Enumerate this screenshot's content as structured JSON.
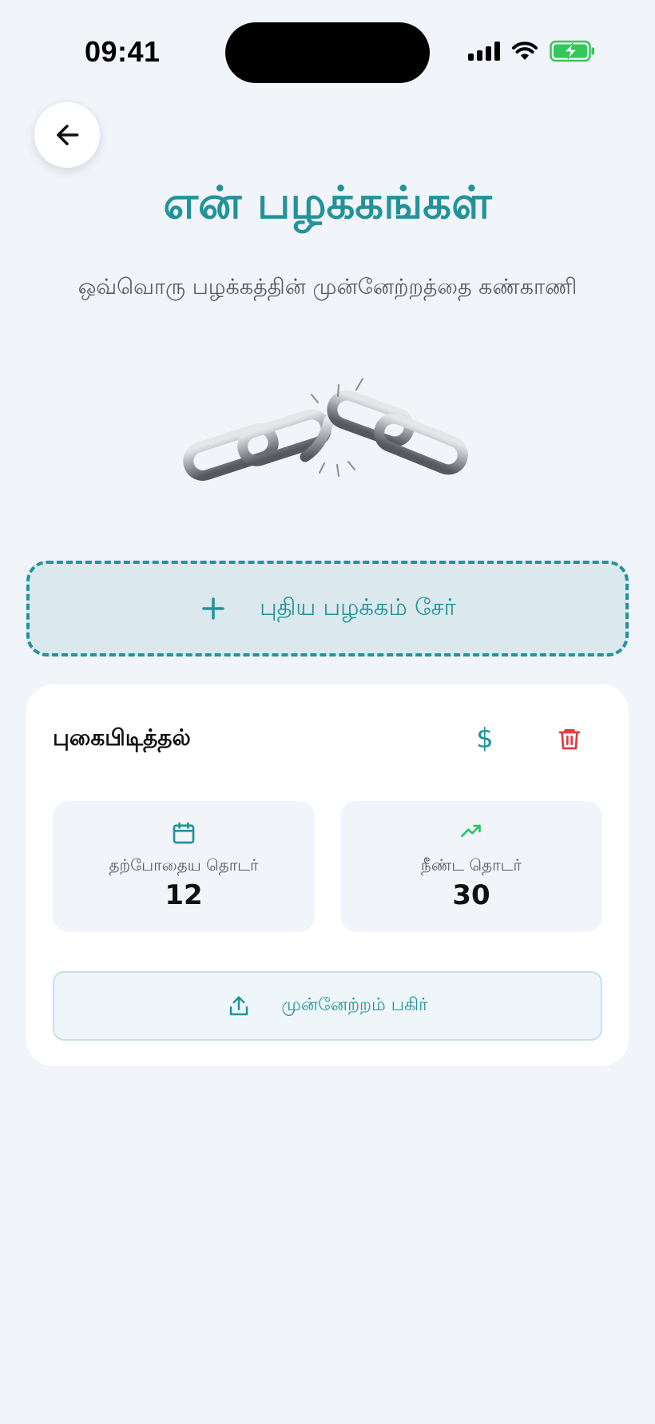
{
  "status_bar": {
    "time": "09:41"
  },
  "header": {
    "title": "என் பழக்கங்கள்",
    "subtitle": "ஒவ்வொரு பழக்கத்தின் முன்னேற்றத்தை கண்காணி"
  },
  "add_habit": {
    "label": "புதிய பழக்கம் சேர்",
    "icon": "plus-icon"
  },
  "habit_card": {
    "name": "புகைபிடித்தல்",
    "money_icon": "$",
    "current_streak": {
      "label": "தற்போதைய தொடர்",
      "value": "12",
      "icon": "calendar-icon"
    },
    "best_streak": {
      "label": "நீண்ட தொடர்",
      "value": "30",
      "icon": "trending-up-icon"
    },
    "share": {
      "label": "முன்னேற்றம் பகிர்",
      "icon": "share-icon"
    }
  },
  "colors": {
    "accent": "#23939a",
    "danger": "#e03a3e",
    "success": "#22c55e",
    "background": "#f1f4f9"
  }
}
